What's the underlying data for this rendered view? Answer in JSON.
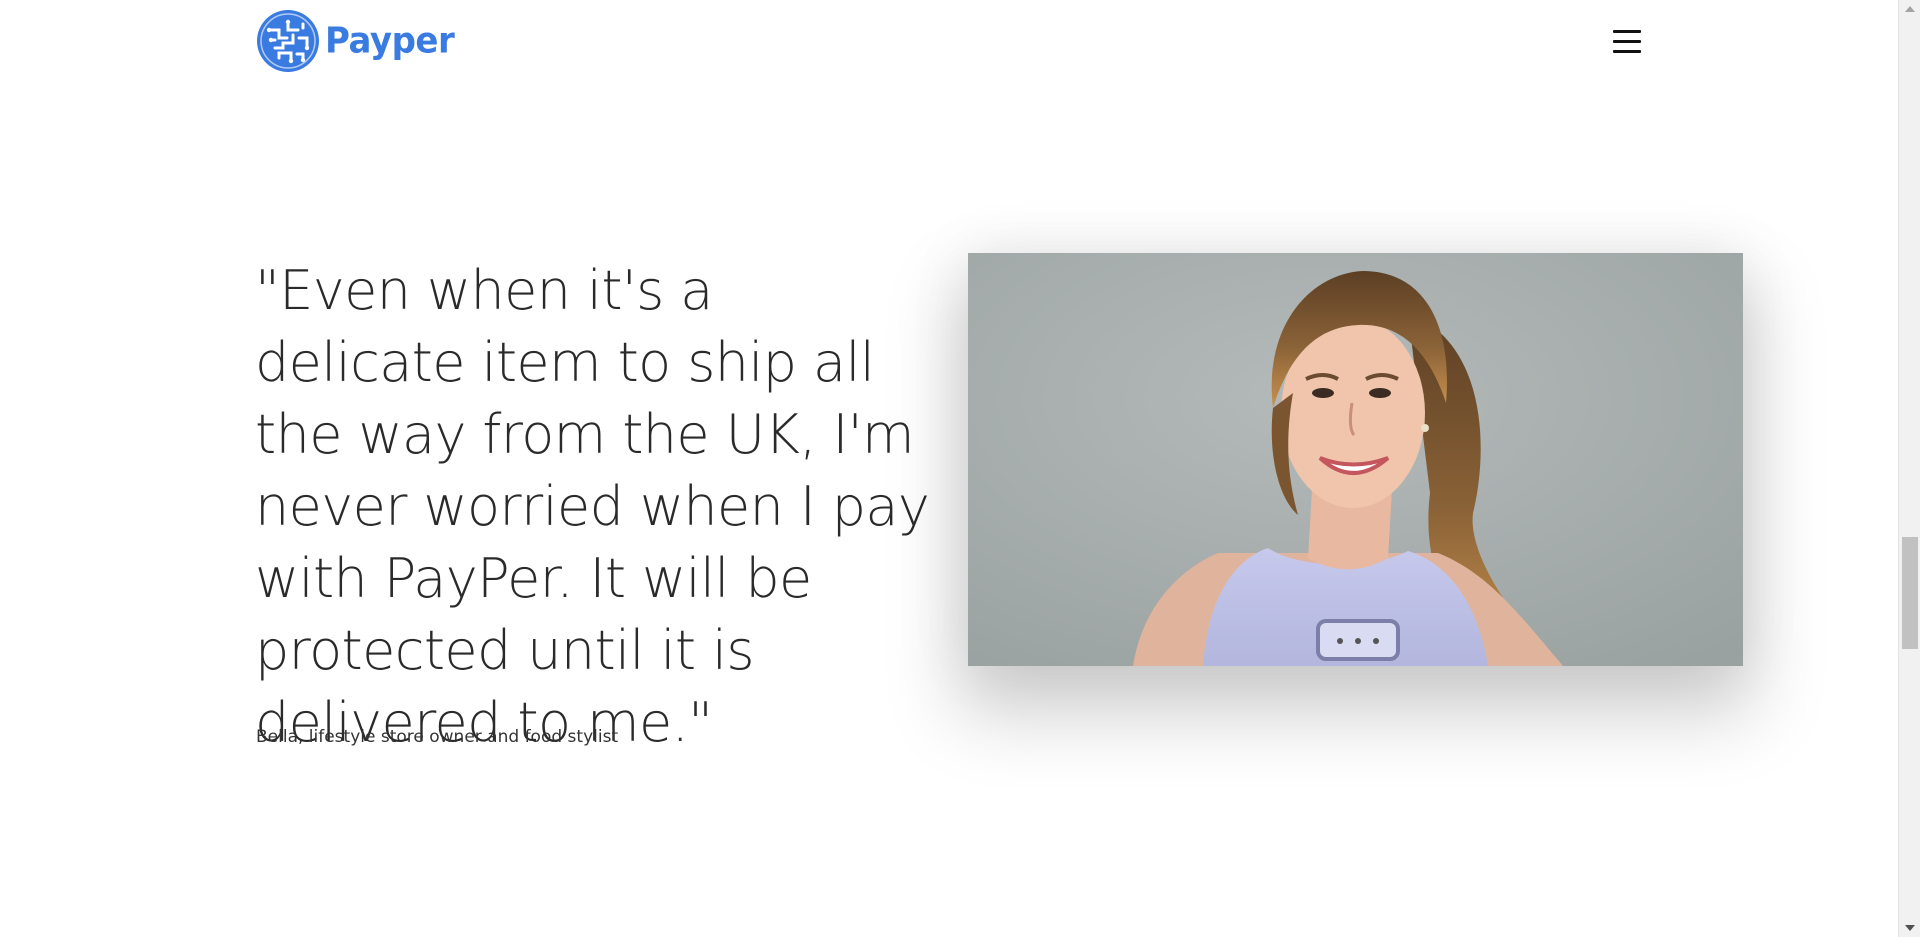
{
  "header": {
    "brand": "Payper",
    "logo_icon": "circuit-globe-logo",
    "menu_icon": "hamburger-menu-icon"
  },
  "testimonial": {
    "quote": "\"Even when it's a delicate item to ship all the way from the UK, I'm never worried when I pay with PayPer. It will be protected until it is delivered to me.\"",
    "author": "Bella, lifestyle store owner and food stylist",
    "photo_icon": "customer-portrait"
  },
  "colors": {
    "brand": "#3a7be2",
    "text": "#2a2a2a",
    "background": "#ffffff"
  },
  "scrollbar": {
    "position": 0.6
  }
}
